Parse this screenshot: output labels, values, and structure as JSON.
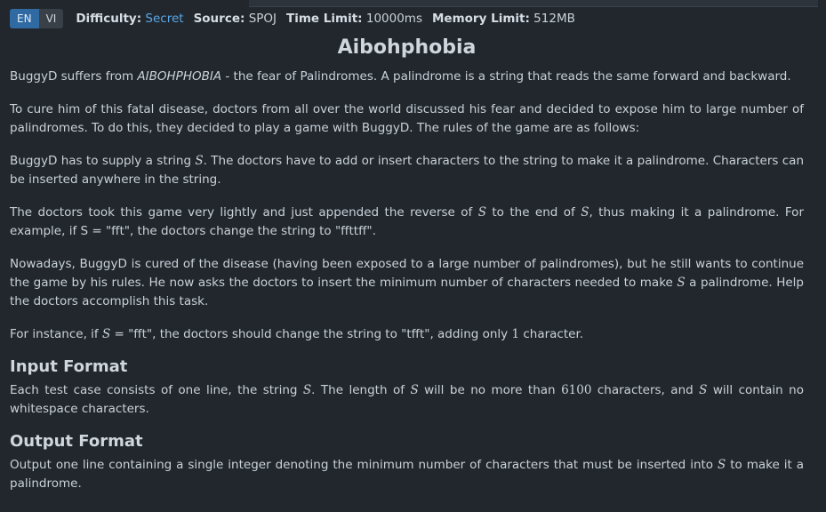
{
  "lang_tabs": [
    "EN",
    "VI"
  ],
  "meta": {
    "difficulty_label": "Difficulty:",
    "difficulty_value": "Secret",
    "source_label": "Source:",
    "source_value": "SPOJ",
    "time_label": "Time Limit:",
    "time_value": "10000ms",
    "memory_label": "Memory Limit:",
    "memory_value": "512MB"
  },
  "problem": {
    "title": "Aibohphobia",
    "p1": [
      "BuggyD suffers from ",
      "AIBOHPHOBIA",
      " - the fear of Palindromes. A palindrome is a string that reads the same forward and backward."
    ],
    "p2": "To cure him of this fatal disease, doctors from all over the world discussed his fear and decided to expose him to large number of palindromes. To do this, they decided to play a game with BuggyD. The rules of the game are as follows:",
    "p3": [
      "BuggyD has to supply a string ",
      "S",
      ". The doctors have to add or insert characters to the string to make it a palindrome. Characters can be inserted anywhere in the string."
    ],
    "p4": [
      "The doctors took this game very lightly and just appended the reverse of ",
      "S",
      " to the end of ",
      "S",
      ", thus making it a palindrome. For example, if S = \"fft\", the doctors change the string to \"ffttff\"."
    ],
    "p5": [
      "Nowadays, BuggyD is cured of the disease (having been exposed to a large number of palindromes), but he still wants to continue the game by his rules. He now asks the doctors to insert the minimum number of characters needed to make ",
      "S",
      " a palindrome. Help the doctors accomplish this task."
    ],
    "p6": [
      "For instance, if ",
      "S",
      " = \"fft\", the doctors should change the string to \"tfft\", adding only ",
      "1",
      " character."
    ],
    "input_heading": "Input Format",
    "input_text": [
      "Each test case consists of one line, the string ",
      "S",
      ". The length of ",
      "S",
      " will be no more than ",
      "6100",
      " characters, and ",
      "S",
      " will contain no whitespace characters."
    ],
    "output_heading": "Output Format",
    "output_text": [
      "Output one line containing a single integer denoting the minimum number of characters that must be inserted into ",
      "S",
      " to make it a palindrome."
    ]
  }
}
